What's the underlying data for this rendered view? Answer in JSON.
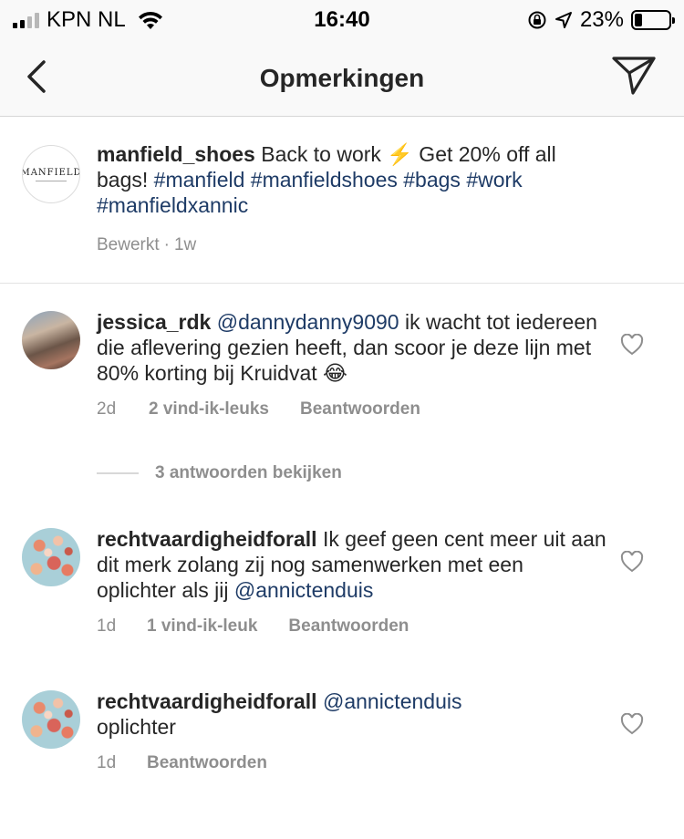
{
  "status_bar": {
    "carrier": "KPN NL",
    "time": "16:40",
    "battery_percent": "23%",
    "battery_level": 0.23,
    "icons": [
      "signal-icon",
      "wifi-icon",
      "rotation-lock-icon",
      "location-arrow-icon",
      "battery-icon"
    ]
  },
  "nav": {
    "title": "Opmerkingen",
    "back_icon": "chevron-left-icon",
    "share_icon": "paper-plane-icon"
  },
  "caption": {
    "username": "manfield_shoes",
    "text": "Back to work ⚡️ Get 20% off all bags!",
    "hashtags": "#manfield #manfieldshoes #bags #work #manfieldxannic",
    "edited": "Bewerkt",
    "separator": "·",
    "age": "1w",
    "avatar_text": "MANFIELD"
  },
  "comments": [
    {
      "username": "jessica_rdk",
      "mention": "@dannydanny9090",
      "text": "ik wacht tot iedereen die aflevering gezien heeft, dan scoor je deze lijn met 80% korting bij Kruidvat 😂",
      "age": "2d",
      "likes": "2 vind-ik-leuks",
      "reply": "Beantwoorden"
    },
    {
      "username": "rechtvaardigheidforall",
      "text": "Ik geef geen cent meer uit aan dit merk zolang zij nog samenwerken met een oplichter als jij",
      "mention": "@annictenduis",
      "age": "1d",
      "likes": "1 vind-ik-leuk",
      "reply": "Beantwoorden"
    },
    {
      "username": "rechtvaardigheidforall",
      "mention": "@annictenduis",
      "text": "oplichter",
      "age": "1d",
      "reply": "Beantwoorden"
    }
  ],
  "view_replies": "3 antwoorden bekijken",
  "colors": {
    "link": "#1e3b66",
    "meta": "#8e8e8e",
    "text": "#262626",
    "bar_bg": "#f9f9f9"
  }
}
